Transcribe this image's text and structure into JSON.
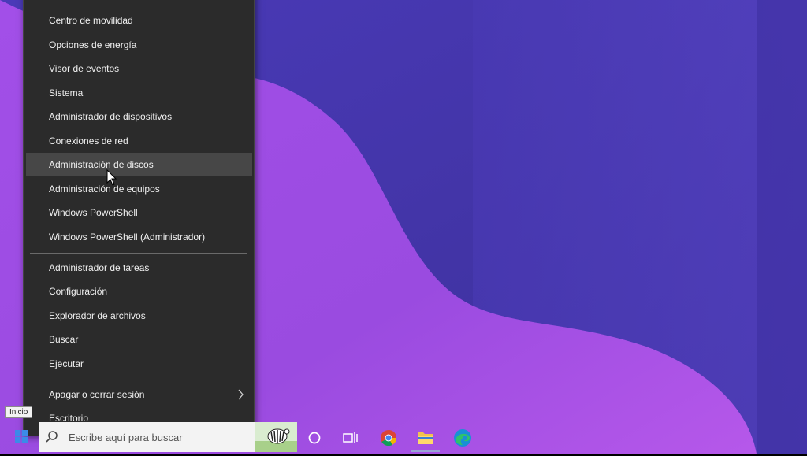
{
  "menu": {
    "items": [
      {
        "label": "Centro de movilidad"
      },
      {
        "label": "Opciones de energía"
      },
      {
        "label": "Visor de eventos"
      },
      {
        "label": "Sistema"
      },
      {
        "label": "Administrador de dispositivos"
      },
      {
        "label": "Conexiones de red"
      },
      {
        "label": "Administración de discos"
      },
      {
        "label": "Administración de equipos"
      },
      {
        "label": "Windows PowerShell"
      },
      {
        "label": "Windows PowerShell (Administrador)"
      },
      {
        "label": "Administrador de tareas"
      },
      {
        "label": "Configuración"
      },
      {
        "label": "Explorador de archivos"
      },
      {
        "label": "Buscar"
      },
      {
        "label": "Ejecutar"
      },
      {
        "label": "Apagar o cerrar sesión"
      },
      {
        "label": "Escritorio"
      }
    ],
    "hovered_item": "Administración de discos",
    "submenu_item": "Apagar o cerrar sesión"
  },
  "taskbar": {
    "start_tooltip": "Inicio",
    "search_placeholder": "Escribe aquí para buscar",
    "pinned_icons": [
      "cortana-circle-icon",
      "task-view-icon",
      "chrome-icon",
      "file-explorer-icon",
      "edge-icon"
    ]
  },
  "colors": {
    "menu_background": "#2b2b2b",
    "menu_hover": "#474747",
    "wallpaper_dark": "#3f2fa8",
    "wallpaper_light": "#9b4fe0"
  }
}
